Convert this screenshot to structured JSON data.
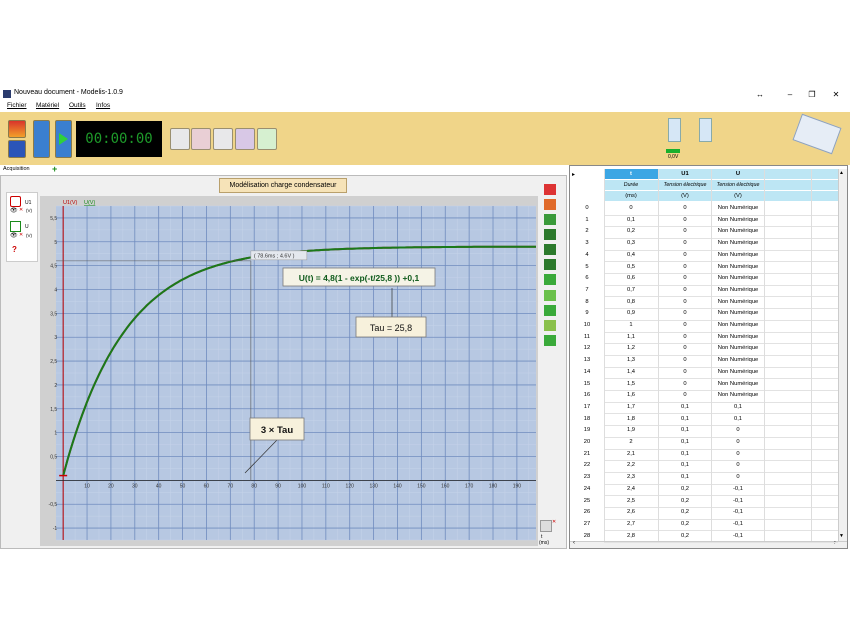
{
  "window": {
    "title": "Nouveau document - Modelis-1.0.9",
    "extra_glyph": "↔"
  },
  "menu": [
    "Fichier",
    "Matériel",
    "Outils",
    "Infos"
  ],
  "toolbar": {
    "timer": "00:00:00",
    "device_reading": "0,0V"
  },
  "tabs": {
    "acquisition": "Acquisition",
    "add": "+"
  },
  "panel_title": "Modélisation charge condensateur",
  "sidebar": {
    "ch1": "U1",
    "ch1_unit": "(V)",
    "ch2": "U",
    "ch2_unit": "(V)",
    "help": "?"
  },
  "chart_data": {
    "type": "line",
    "ylabel_series": [
      "U1(V)",
      "U(V)"
    ],
    "xlabel": "t",
    "xunit": "(ms)",
    "xlim": [
      -3,
      198
    ],
    "ylim": [
      -1.25,
      5.75
    ],
    "xticks": [
      0,
      10,
      20,
      30,
      40,
      50,
      60,
      70,
      80,
      90,
      100,
      110,
      120,
      130,
      140,
      150,
      160,
      170,
      180,
      190
    ],
    "yticks": [
      -1,
      -0.5,
      0,
      0.5,
      1,
      1.5,
      2,
      2.5,
      3,
      3.5,
      4,
      4.5,
      5,
      5.5
    ],
    "ytick_labels": [
      "-1",
      "-0,5",
      "",
      "0,5",
      "1",
      "1,5",
      "2",
      "2,5",
      "3",
      "3,5",
      "4",
      "4,5",
      "5",
      "5,5"
    ],
    "series": [
      {
        "name": "U1(V)",
        "color": "#1a7a1a",
        "model": {
          "A": 4.8,
          "tau": 25.8,
          "offset": 0.1
        },
        "x_end": 198
      }
    ],
    "cursor": {
      "x": 78.6,
      "y": 4.6,
      "label": "( 78.6ms ; 4.6V )"
    },
    "annotations": {
      "equation": "U(t) = 4,8(1 - exp(-t/25,8 )) +0,1",
      "tau": "Tau = 25,8",
      "three_tau": "3 × Tau"
    },
    "grid": true
  },
  "table": {
    "columns": [
      {
        "name": "t",
        "desc": "Durée",
        "unit": "(ms)"
      },
      {
        "name": "U1",
        "desc": "Tension électrique",
        "unit": "(V)"
      },
      {
        "name": "U",
        "desc": "Tension électrique",
        "unit": "(V)"
      }
    ],
    "rows": [
      [
        "0",
        "0",
        "0",
        "Non Numérique"
      ],
      [
        "1",
        "0,1",
        "0",
        "Non Numérique"
      ],
      [
        "2",
        "0,2",
        "0",
        "Non Numérique"
      ],
      [
        "3",
        "0,3",
        "0",
        "Non Numérique"
      ],
      [
        "4",
        "0,4",
        "0",
        "Non Numérique"
      ],
      [
        "5",
        "0,5",
        "0",
        "Non Numérique"
      ],
      [
        "6",
        "0,6",
        "0",
        "Non Numérique"
      ],
      [
        "7",
        "0,7",
        "0",
        "Non Numérique"
      ],
      [
        "8",
        "0,8",
        "0",
        "Non Numérique"
      ],
      [
        "9",
        "0,9",
        "0",
        "Non Numérique"
      ],
      [
        "10",
        "1",
        "0",
        "Non Numérique"
      ],
      [
        "11",
        "1,1",
        "0",
        "Non Numérique"
      ],
      [
        "12",
        "1,2",
        "0",
        "Non Numérique"
      ],
      [
        "13",
        "1,3",
        "0",
        "Non Numérique"
      ],
      [
        "14",
        "1,4",
        "0",
        "Non Numérique"
      ],
      [
        "15",
        "1,5",
        "0",
        "Non Numérique"
      ],
      [
        "16",
        "1,6",
        "0",
        "Non Numérique"
      ],
      [
        "17",
        "1,7",
        "0,1",
        "0,1"
      ],
      [
        "18",
        "1,8",
        "0,1",
        "0,1"
      ],
      [
        "19",
        "1,9",
        "0,1",
        "0"
      ],
      [
        "20",
        "2",
        "0,1",
        "0"
      ],
      [
        "21",
        "2,1",
        "0,1",
        "0"
      ],
      [
        "22",
        "2,2",
        "0,1",
        "0"
      ],
      [
        "23",
        "2,3",
        "0,1",
        "0"
      ],
      [
        "24",
        "2,4",
        "0,2",
        "-0,1"
      ],
      [
        "25",
        "2,5",
        "0,2",
        "-0,1"
      ],
      [
        "26",
        "2,6",
        "0,2",
        "-0,1"
      ],
      [
        "27",
        "2,7",
        "0,2",
        "-0,1"
      ],
      [
        "28",
        "2,8",
        "0,2",
        "-0,1"
      ]
    ]
  }
}
